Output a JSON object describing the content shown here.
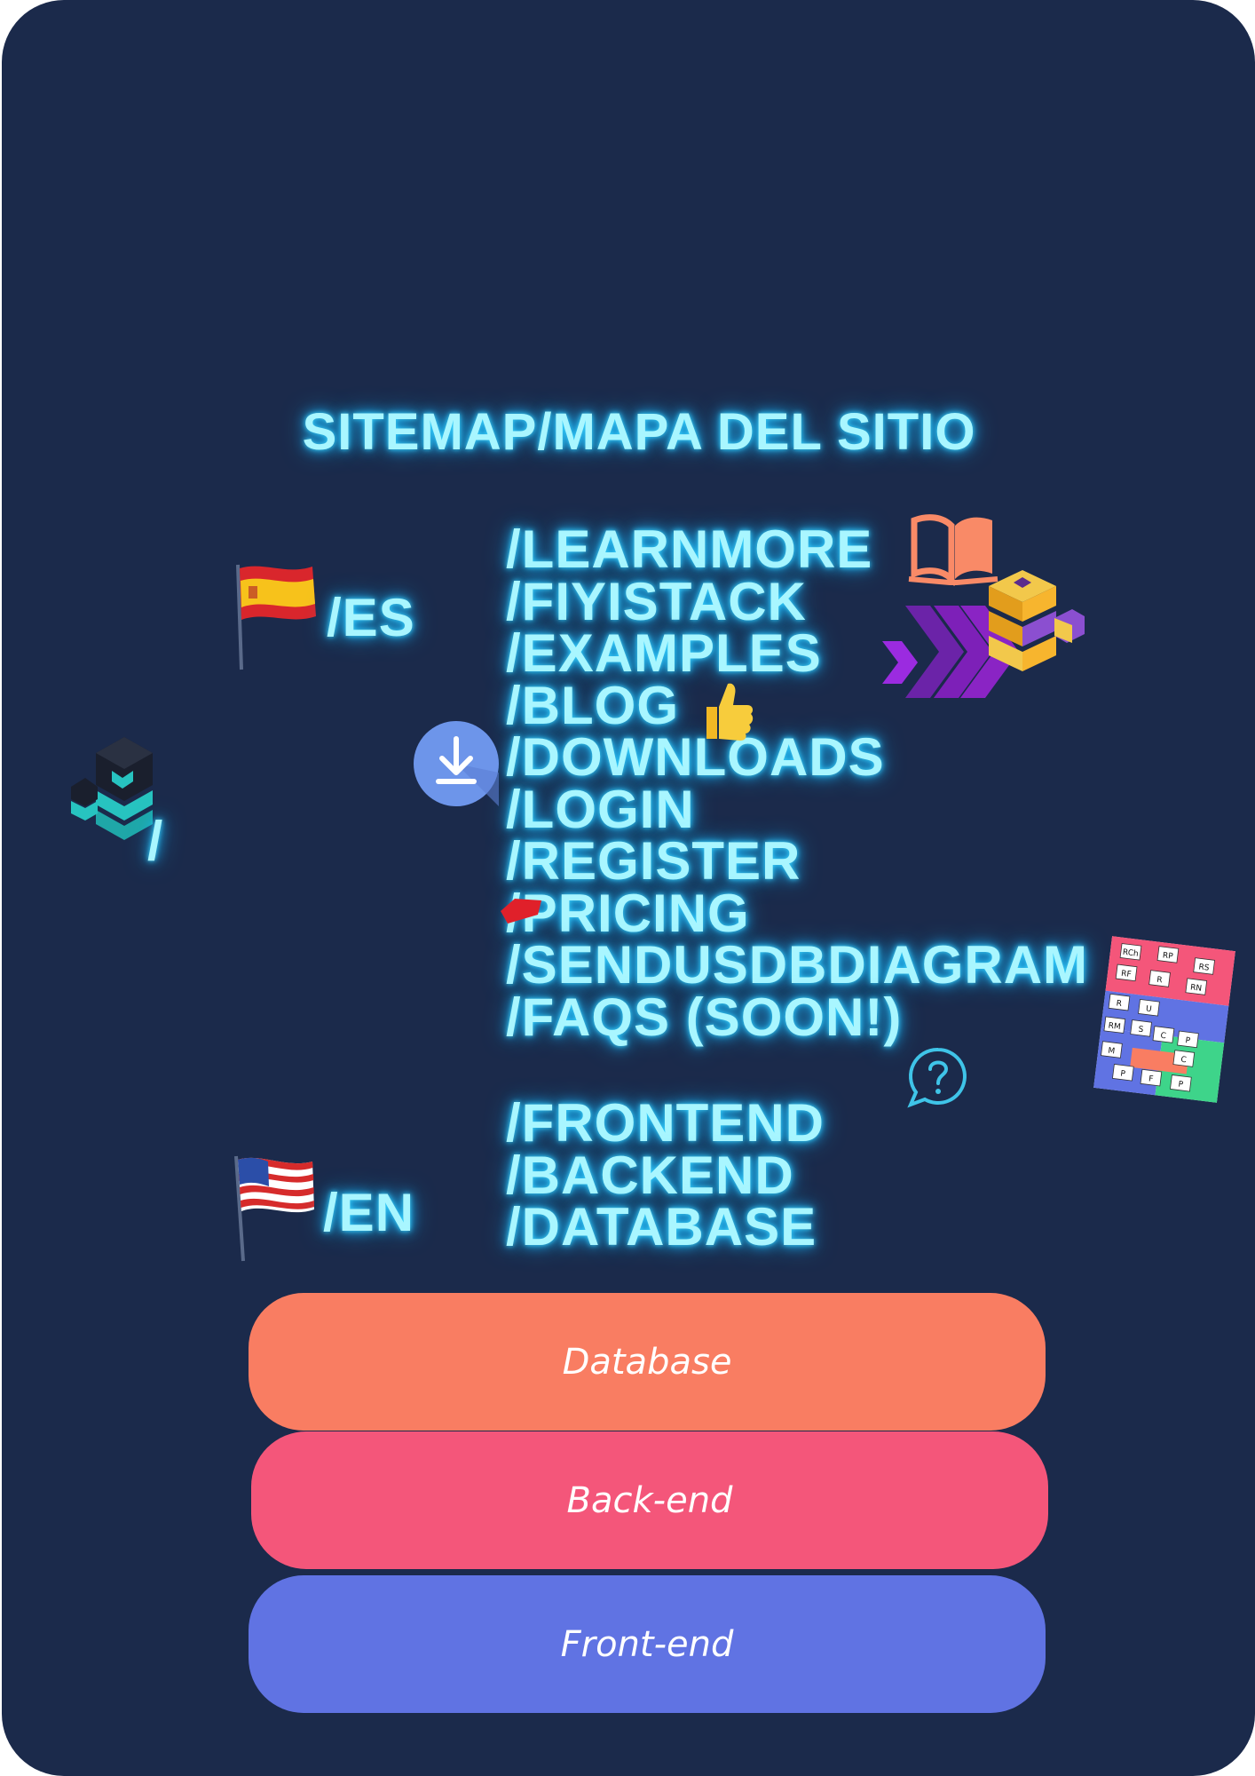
{
  "title": "SITEMAP/MAPA DEL SITIO",
  "root_path": "/",
  "languages": {
    "es": "/ES",
    "en": "/EN"
  },
  "routes": [
    "/LEARNMORE",
    "/FIYISTACK",
    "/EXAMPLES",
    "/BLOG",
    "/DOWNLOADS",
    "/LOGIN",
    "/REGISTER",
    "/PRICING",
    "/SENDUSDBDIAGRAM",
    "/FAQS (SOON!)"
  ],
  "sections": [
    "/FRONTEND",
    "/BACKEND",
    "/DATABASE"
  ],
  "stack_layers": {
    "database": "Database",
    "backend": "Back-end",
    "frontend": "Front-end"
  },
  "diagram_labels": [
    "RCh",
    "RP",
    "RS",
    "RF",
    "R",
    "RN",
    "R",
    "U",
    "RM",
    "S",
    "C",
    "P",
    "M",
    "C",
    "P",
    "F",
    "P"
  ],
  "colors": {
    "background": "#1b2a4b",
    "glow_text": "#a9f6ff",
    "database_layer": "#f97d62",
    "backend_layer": "#f4567a",
    "frontend_layer": "#6073e3"
  },
  "icons": [
    "spain-flag-icon",
    "usa-flag-icon",
    "fiyistack-logo-icon",
    "book-icon",
    "stack-cubes-icon",
    "chevrons-icon",
    "thumbs-up-icon",
    "download-icon",
    "price-tag-icon",
    "db-diagram-icon",
    "question-bubble-icon"
  ]
}
